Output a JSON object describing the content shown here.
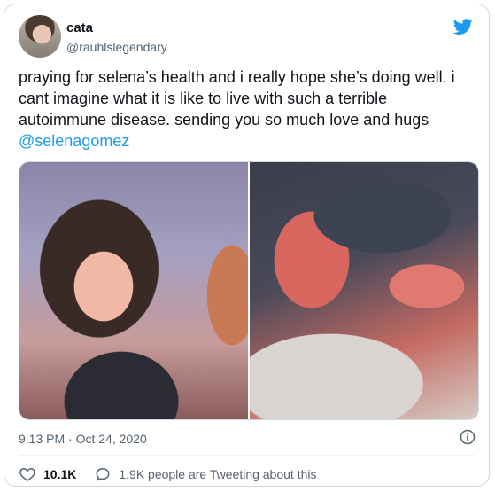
{
  "author": {
    "name": "cata",
    "handle": "@rauhlslegendary"
  },
  "tweet": {
    "text": "praying for selena’s health and i really hope she’s doing well. i cant imagine what it is like to live with such a terrible autoimmune disease. sending you so much love and hugs",
    "mention": "@selenagomez"
  },
  "meta": {
    "timestamp": "9:13 PM · Oct 24, 2020"
  },
  "actions": {
    "likes": "10.1K",
    "tweeting": "1.9K people are Tweeting about this"
  },
  "colors": {
    "accent": "#1d9bf0",
    "secondary_text": "#536471",
    "border": "#cfd9de"
  },
  "icons": [
    "twitter-bird-icon",
    "info-icon",
    "heart-icon",
    "speech-bubble-icon"
  ]
}
